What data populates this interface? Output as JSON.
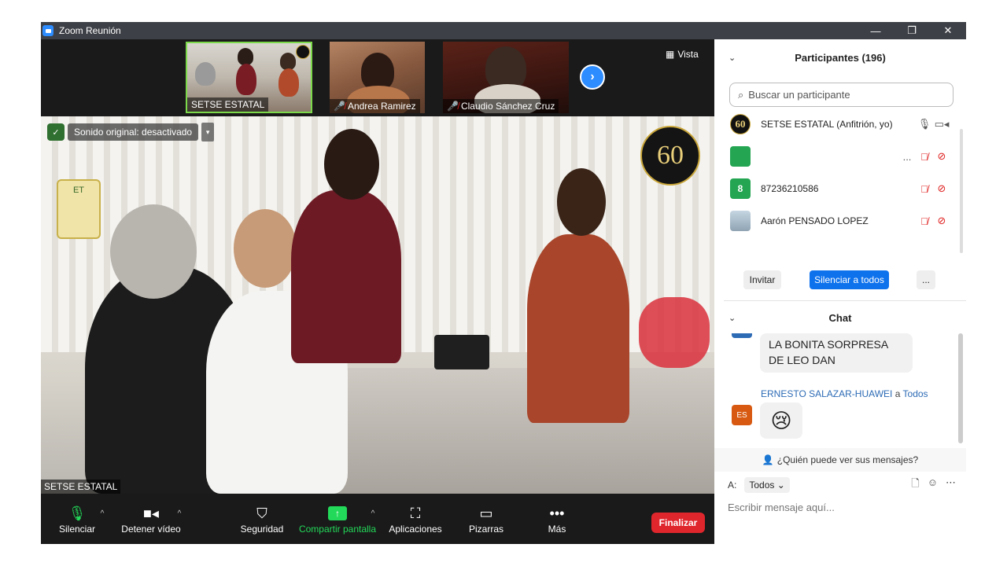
{
  "window": {
    "title": "Zoom Reunión",
    "controls": {
      "minimize": "—",
      "restore": "❐",
      "close": "✕"
    }
  },
  "thumbnails": [
    {
      "name": "SETSE ESTATAL",
      "muted": false
    },
    {
      "name": "Andrea Ramirez",
      "muted": true
    },
    {
      "name": "Claudio Sánchez Cruz",
      "muted": true
    }
  ],
  "view": {
    "label": "Vista"
  },
  "main_video": {
    "original_sound": "Sonido original: desactivado",
    "name": "SETSE ESTATAL",
    "badge": "60",
    "logo_text": "ET"
  },
  "toolbar": {
    "mute": "Silenciar",
    "stop_video": "Detener vídeo",
    "security": "Seguridad",
    "share": "Compartir pantalla",
    "apps": "Aplicaciones",
    "whiteboards": "Pizarras",
    "more": "Más",
    "end": "Finalizar",
    "colors": {
      "share_green": "#23d959",
      "end_red": "#e0262d"
    }
  },
  "participants": {
    "header": "Participantes (196)",
    "search_placeholder": "Buscar un participante",
    "list": [
      {
        "avatar": "60",
        "name": "SETSE ESTATAL (Anfitrión, yo)",
        "extra": "",
        "avatar_color": "#111111"
      },
      {
        "avatar": "",
        "name": "",
        "extra": "...",
        "avatar_color": "#23a552"
      },
      {
        "avatar": "8",
        "name": "87236210586",
        "extra": "",
        "avatar_color": "#23a552"
      },
      {
        "avatar": "",
        "name": "Aarón PENSADO LOPEZ",
        "extra": "",
        "avatar_color": "#8fb0c8"
      }
    ],
    "invite": "Invitar",
    "mute_all": "Silenciar a todos",
    "more": "..."
  },
  "chat": {
    "header": "Chat",
    "messages": [
      {
        "text": "LA BONITA SORPRESA DE LEO DAN"
      },
      {
        "sender": "ERNESTO SALAZAR-HUAWEI",
        "to_word": "a",
        "recipient": "Todos",
        "avatar": "ES",
        "avatar_color": "#d85a12",
        "text": "😢"
      }
    ],
    "who_can_see": "¿Quién puede ver sus mensajes?",
    "to_label": "A:",
    "to_value": "Todos",
    "input_placeholder": "Escribir mensaje aquí..."
  }
}
